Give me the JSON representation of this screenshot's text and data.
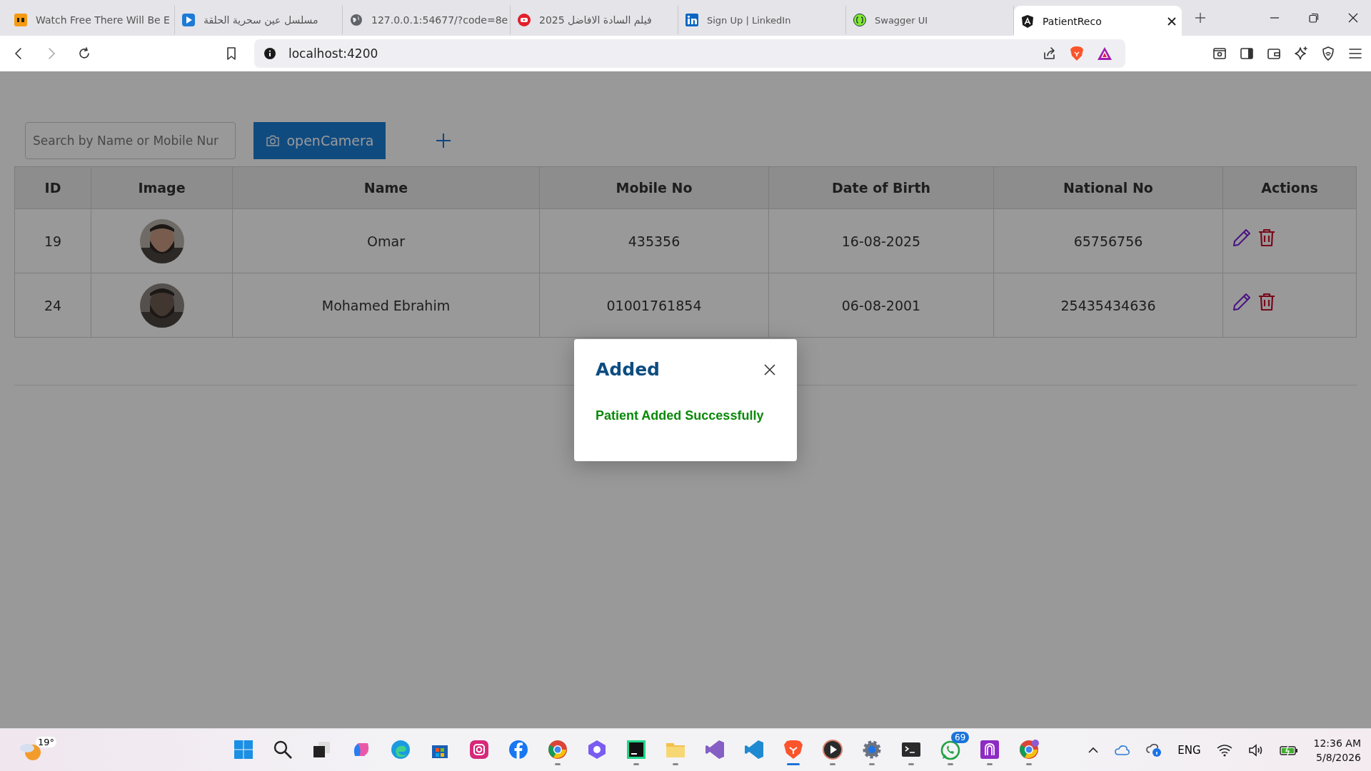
{
  "browser": {
    "tabs": [
      {
        "title": "Watch Free There Will Be E",
        "selected": false
      },
      {
        "title": "مسلسل عين سحرية الحلقة",
        "selected": false
      },
      {
        "title": "127.0.0.1:54677/?code=8e",
        "selected": false
      },
      {
        "title": "فيلم السادة الافاضل 2025",
        "selected": false
      },
      {
        "title": "Sign Up | LinkedIn",
        "selected": false
      },
      {
        "title": "Swagger UI",
        "selected": false
      },
      {
        "title": "PatientReco",
        "selected": true
      }
    ],
    "address": "localhost:4200"
  },
  "toolbar": {
    "search": {
      "placeholder": "Search by Name or Mobile Nur"
    },
    "camera_button": "openCamera"
  },
  "table": {
    "columns": [
      "ID",
      "Image",
      "Name",
      "Mobile No",
      "Date of Birth",
      "National No",
      "Actions"
    ],
    "rows": [
      {
        "id": "19",
        "name": "Omar",
        "mobile": "435356",
        "dob": "16-08-2025",
        "national": "65756756"
      },
      {
        "id": "24",
        "name": "Mohamed Ebrahim",
        "mobile": "01001761854",
        "dob": "06-08-2001",
        "national": "25435434636"
      }
    ]
  },
  "dialog": {
    "title": "Added",
    "message": "Patient Added Successfully"
  },
  "taskbar": {
    "weather": "19°",
    "whatsapp_badge": "69",
    "language": "ENG",
    "time": "12:36 AM",
    "date": "5/8/2026"
  }
}
